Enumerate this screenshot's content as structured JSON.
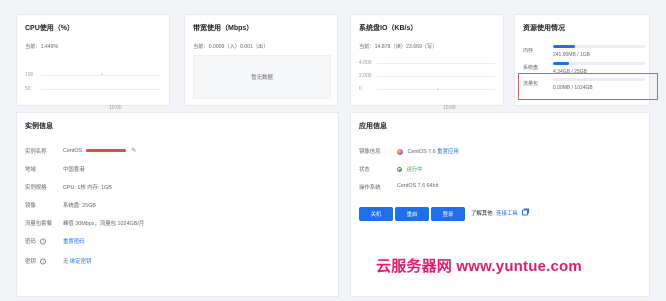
{
  "cards": {
    "cpu": {
      "title": "CPU使用（%）",
      "current": "当前：1.449%",
      "y_labels": [
        "100",
        "50"
      ],
      "x_label": "10:00"
    },
    "bandwidth": {
      "title": "带宽使用（Mbps）",
      "current": "当前：0.0009（入）0.001（出）",
      "empty": "暂无数据"
    },
    "disk_io": {
      "title": "系统盘IO（KB/s）",
      "current": "当前：14.878（读）23.669（写）",
      "y_labels": [
        "4,000",
        "2,000",
        "0"
      ],
      "x_label": "10:00"
    },
    "resources": {
      "title": "资源使用情况",
      "items": [
        {
          "label": "内存",
          "value": "241.90MB / 1GB",
          "fill": 0.24
        },
        {
          "label": "系统盘",
          "value": "4.34GB / 25GB",
          "fill": 0.17
        },
        {
          "label": "流量包",
          "value": "0.00MB / 1024GB",
          "fill": 0.0
        }
      ]
    }
  },
  "instance": {
    "title": "实例信息",
    "rows": [
      {
        "key": "实例名称",
        "value": "CentOS"
      },
      {
        "key": "地域",
        "value": "中国香港"
      },
      {
        "key": "实例规格",
        "value": "CPU: 1核 内存: 1GB"
      },
      {
        "key": "镜像",
        "value": "系统盘: 25GB"
      },
      {
        "key": "流量包套餐",
        "value": "峰值 30Mbps，流量包 1024GB/月"
      },
      {
        "key": "密码",
        "value": "重置密码"
      },
      {
        "key": "密钥",
        "value": "绑定密钥",
        "prefix": "无"
      }
    ]
  },
  "app": {
    "title": "应用信息",
    "rows": [
      {
        "key": "镜像信息",
        "value": "CentOS 7.6",
        "link": "重置应用"
      },
      {
        "key": "状态",
        "value": "运行中"
      },
      {
        "key": "操作系统",
        "value": "CentOS 7.6 64bit"
      }
    ],
    "buttons": [
      "关机",
      "重启",
      "登录"
    ],
    "more": {
      "label": "了解其他",
      "link": "连接工具"
    }
  },
  "watermark": "云服务器网 www.yuntue.com",
  "colors": {
    "accent": "#1f6feb",
    "highlight": "#e15a5a",
    "redaction": "#e24a4a",
    "status_green": "#28a745"
  }
}
